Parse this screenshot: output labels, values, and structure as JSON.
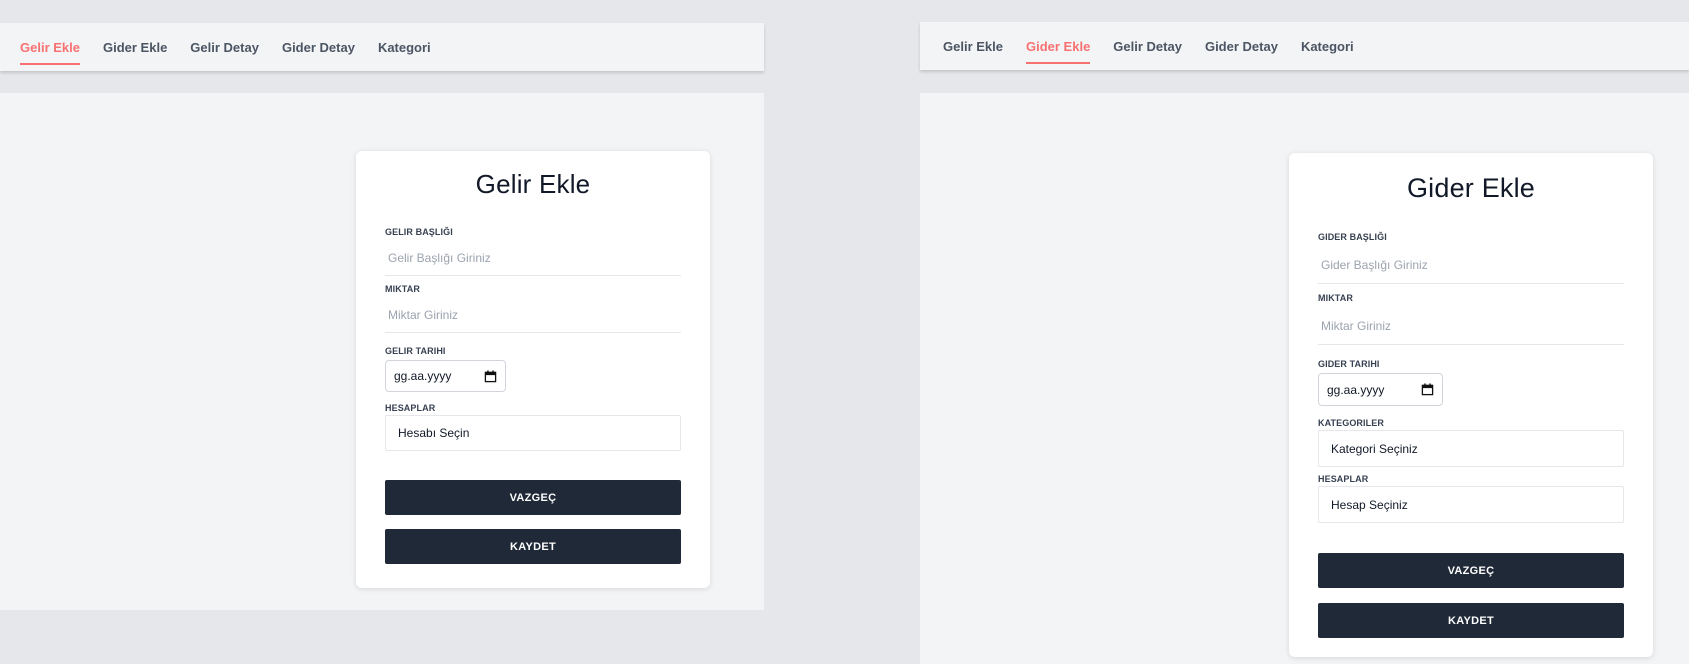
{
  "nav_items": [
    "Gelir Ekle",
    "Gider Ekle",
    "Gelir Detay",
    "Gider Detay",
    "Kategori"
  ],
  "left": {
    "title": "Gelir Ekle",
    "title_label": "GELIR BAŞLIĞI",
    "title_placeholder": "Gelir Başlığı Giriniz",
    "amount_label": "MIKTAR",
    "amount_placeholder": "Miktar Giriniz",
    "date_label": "GELIR TARIHI",
    "date_value": "gg.aa.yyyy",
    "accounts_label": "HESAPLAR",
    "accounts_value": "Hesabı Seçin",
    "cancel_label": "VAZGEÇ",
    "save_label": "KAYDET"
  },
  "right": {
    "title": "Gider Ekle",
    "title_label": "GIDER BAŞLIĞI",
    "title_placeholder": "Gider Başlığı Giriniz",
    "amount_label": "MIKTAR",
    "amount_placeholder": "Miktar Giriniz",
    "date_label": "GIDER TARIHI",
    "date_value": "gg.aa.yyyy",
    "categories_label": "KATEGORILER",
    "categories_value": "Kategori Seçiniz",
    "accounts_label": "HESAPLAR",
    "accounts_value": "Hesap Seçiniz",
    "cancel_label": "VAZGEÇ",
    "save_label": "KAYDET"
  },
  "colors": {
    "accent": "#f87171",
    "button": "#1f2937",
    "nav_bg": "#f3f4f6",
    "page_bg": "#e5e7eb"
  },
  "icons": {
    "date_picker": "calendar-icon"
  }
}
